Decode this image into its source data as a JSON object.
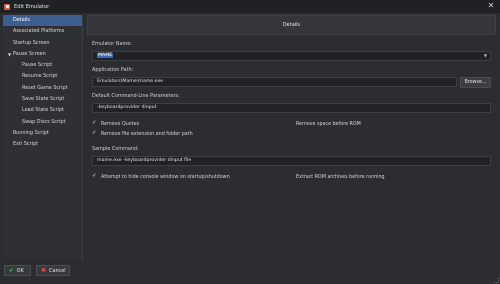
{
  "window": {
    "title": "Edit Emulator",
    "close_glyph": "✕",
    "icon": "launchbox-app-icon"
  },
  "sidebar": {
    "items": [
      {
        "label": "Details",
        "active": true
      },
      {
        "label": "Associated Platforms"
      },
      {
        "label": "Startup Screen"
      },
      {
        "label": "Pause Screen",
        "expanded": true
      },
      {
        "label": "Pause Script",
        "child": true
      },
      {
        "label": "Resume Script",
        "child": true
      },
      {
        "label": "Reset Game Script",
        "child": true
      },
      {
        "label": "Save State Script",
        "child": true
      },
      {
        "label": "Load State Script",
        "child": true
      },
      {
        "label": "Swap Discs Script",
        "child": true
      },
      {
        "label": "Running Script"
      },
      {
        "label": "Exit Script"
      }
    ]
  },
  "panel": {
    "header": "Details",
    "emulator_name_label": "Emulator Name:",
    "emulator_name_value": "MAME",
    "app_path_label": "Application Path:",
    "app_path_value": "Emulators\\Mame\\mame.exe",
    "browse_label": "Browse...",
    "cmdline_label": "Default Command-Line Parameters:",
    "cmdline_value": "-keyboardprovider dinput",
    "checkboxes": {
      "remove_quotes": {
        "label": "Remove Quotes",
        "checked": true
      },
      "remove_space": {
        "label": "Remove space before ROM",
        "checked": false
      },
      "remove_ext": {
        "label": "Remove file extension and folder path",
        "checked": true
      },
      "hide_console": {
        "label": "Attempt to hide console window on startup/shutdown",
        "checked": true
      },
      "extract_rom": {
        "label": "Extract ROM archives before running",
        "checked": false
      }
    },
    "sample_label": "Sample Command:",
    "sample_value": "mame.exe -keyboardprovider dinput file"
  },
  "footer": {
    "ok_label": "OK",
    "cancel_label": "Cancel"
  },
  "colors": {
    "selection": "#3d5e91",
    "ok": "#5fc15f",
    "cancel": "#e0534a"
  }
}
